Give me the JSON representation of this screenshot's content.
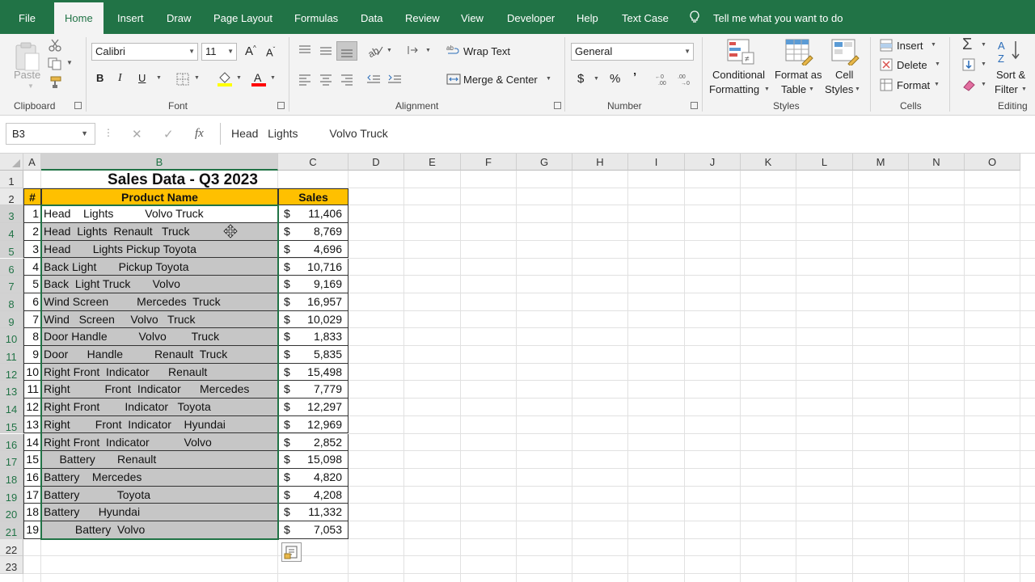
{
  "menu": {
    "tabs": [
      "File",
      "Home",
      "Insert",
      "Draw",
      "Page Layout",
      "Formulas",
      "Data",
      "Review",
      "View",
      "Developer",
      "Help",
      "Text Case"
    ],
    "active": "Home",
    "tell_me": "Tell me what you want to do"
  },
  "ribbon": {
    "clipboard": {
      "paste": "Paste",
      "label": "Clipboard"
    },
    "font": {
      "name": "Calibri",
      "size": "11",
      "label": "Font",
      "fill_color": "#ffff00",
      "font_color": "#ff0000"
    },
    "alignment": {
      "wrap_text": "Wrap Text",
      "merge_center": "Merge & Center",
      "label": "Alignment"
    },
    "number": {
      "format": "General",
      "currency": "$",
      "percent": "%",
      "comma": "’",
      "label": "Number"
    },
    "styles": {
      "conditional": "Conditional",
      "formatting": "Formatting",
      "format_as": "Format as",
      "table": "Table",
      "cell": "Cell",
      "cell_styles": "Styles",
      "label": "Styles"
    },
    "cells": {
      "insert": "Insert",
      "delete": "Delete",
      "format": "Format",
      "label": "Cells"
    },
    "editing": {
      "sort": "Sort &",
      "filter": "Filter",
      "label": "Editing"
    }
  },
  "formula_bar": {
    "name_box": "B3",
    "cancel": "✕",
    "enter": "✓",
    "fx": "fx",
    "value": "Head   Lights          Volvo Truck"
  },
  "sheet": {
    "columns": [
      "A",
      "B",
      "C",
      "D",
      "E",
      "F",
      "G",
      "H",
      "I",
      "J",
      "K",
      "L",
      "M",
      "N",
      "O"
    ],
    "row_numbers": [
      "1",
      "2",
      "3",
      "4",
      "5",
      "6",
      "7",
      "8",
      "9",
      "10",
      "11",
      "12",
      "13",
      "14",
      "15",
      "16",
      "17",
      "18",
      "19",
      "20",
      "21",
      "22",
      "23"
    ],
    "title": "Sales Data - Q3 2023",
    "headers": {
      "num": "#",
      "product": "Product Name",
      "sales": "Sales"
    },
    "header_color": "#ffc000",
    "selection_color": "#217346",
    "rows": [
      {
        "num": "1",
        "product": "Head    Lights          Volvo Truck",
        "currency": "$",
        "sales": "11,406"
      },
      {
        "num": "2",
        "product": "Head  Lights  Renault   Truck",
        "currency": "$",
        "sales": "8,769"
      },
      {
        "num": "3",
        "product": "Head       Lights Pickup Toyota",
        "currency": "$",
        "sales": "4,696"
      },
      {
        "num": "4",
        "product": "Back Light       Pickup Toyota",
        "currency": "$",
        "sales": "10,716"
      },
      {
        "num": "5",
        "product": "Back  Light Truck       Volvo",
        "currency": "$",
        "sales": "9,169"
      },
      {
        "num": "6",
        "product": "Wind Screen         Mercedes  Truck",
        "currency": "$",
        "sales": "16,957"
      },
      {
        "num": "7",
        "product": "Wind   Screen     Volvo   Truck",
        "currency": "$",
        "sales": "10,029"
      },
      {
        "num": "8",
        "product": "Door Handle          Volvo        Truck",
        "currency": "$",
        "sales": "1,833"
      },
      {
        "num": "9",
        "product": "Door      Handle          Renault  Truck",
        "currency": "$",
        "sales": "5,835"
      },
      {
        "num": "10",
        "product": "Right Front  Indicator      Renault",
        "currency": "$",
        "sales": "15,498"
      },
      {
        "num": "11",
        "product": "Right           Front  Indicator      Mercedes",
        "currency": "$",
        "sales": "7,779"
      },
      {
        "num": "12",
        "product": "Right Front        Indicator   Toyota",
        "currency": "$",
        "sales": "12,297"
      },
      {
        "num": "13",
        "product": "Right        Front  Indicator    Hyundai",
        "currency": "$",
        "sales": "12,969"
      },
      {
        "num": "14",
        "product": "Right Front  Indicator           Volvo",
        "currency": "$",
        "sales": "2,852"
      },
      {
        "num": "15",
        "product": "     Battery       Renault",
        "currency": "$",
        "sales": "15,098"
      },
      {
        "num": "16",
        "product": "Battery    Mercedes",
        "currency": "$",
        "sales": "4,820"
      },
      {
        "num": "17",
        "product": "Battery            Toyota",
        "currency": "$",
        "sales": "4,208"
      },
      {
        "num": "18",
        "product": "Battery      Hyundai",
        "currency": "$",
        "sales": "11,332"
      },
      {
        "num": "19",
        "product": "          Battery  Volvo",
        "currency": "$",
        "sales": "7,053"
      }
    ]
  }
}
